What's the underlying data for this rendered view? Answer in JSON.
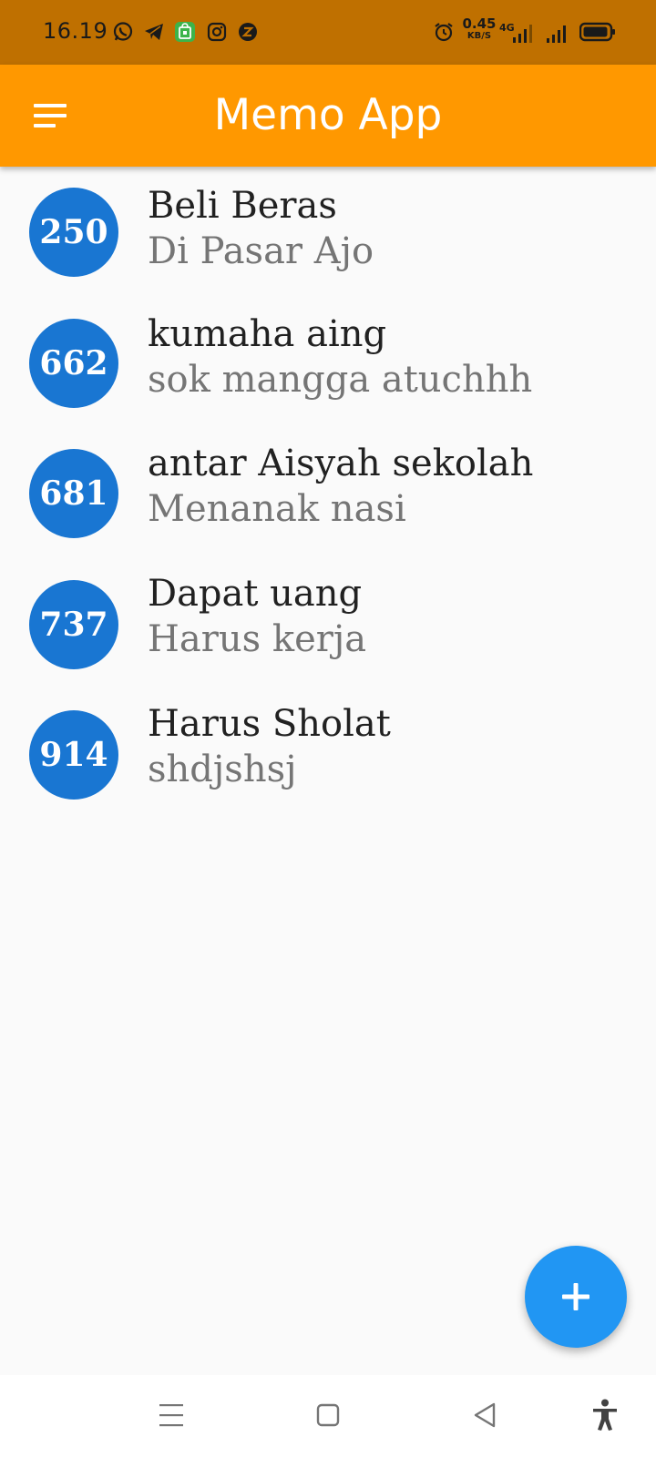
{
  "status_bar": {
    "time": "16.19",
    "net_speed_value": "0.45",
    "net_speed_unit": "KB/S",
    "network_type": "4G",
    "icons": [
      "whatsapp-icon",
      "telegram-icon",
      "shop-app-icon",
      "instagram-icon",
      "z-app-icon",
      "alarm-icon",
      "signal-icon",
      "signal-icon-2",
      "battery-icon"
    ]
  },
  "app_bar": {
    "title": "Memo App",
    "menu_icon": "menu-icon",
    "color": "#ff9800"
  },
  "memos": [
    {
      "id": "250",
      "title": "Beli Beras",
      "subtitle": "Di Pasar Ajo"
    },
    {
      "id": "662",
      "title": "kumaha aing",
      "subtitle": "sok mangga atuchhh"
    },
    {
      "id": "681",
      "title": "antar Aisyah sekolah",
      "subtitle": "Menanak nasi"
    },
    {
      "id": "737",
      "title": "Dapat uang",
      "subtitle": "Harus kerja"
    },
    {
      "id": "914",
      "title": "Harus Sholat",
      "subtitle": "shdjshsj"
    }
  ],
  "fab": {
    "icon": "plus-icon",
    "color": "#2196f3"
  },
  "nav_bar": {
    "icons": [
      "recents-icon",
      "home-icon",
      "back-icon",
      "accessibility-icon"
    ]
  }
}
